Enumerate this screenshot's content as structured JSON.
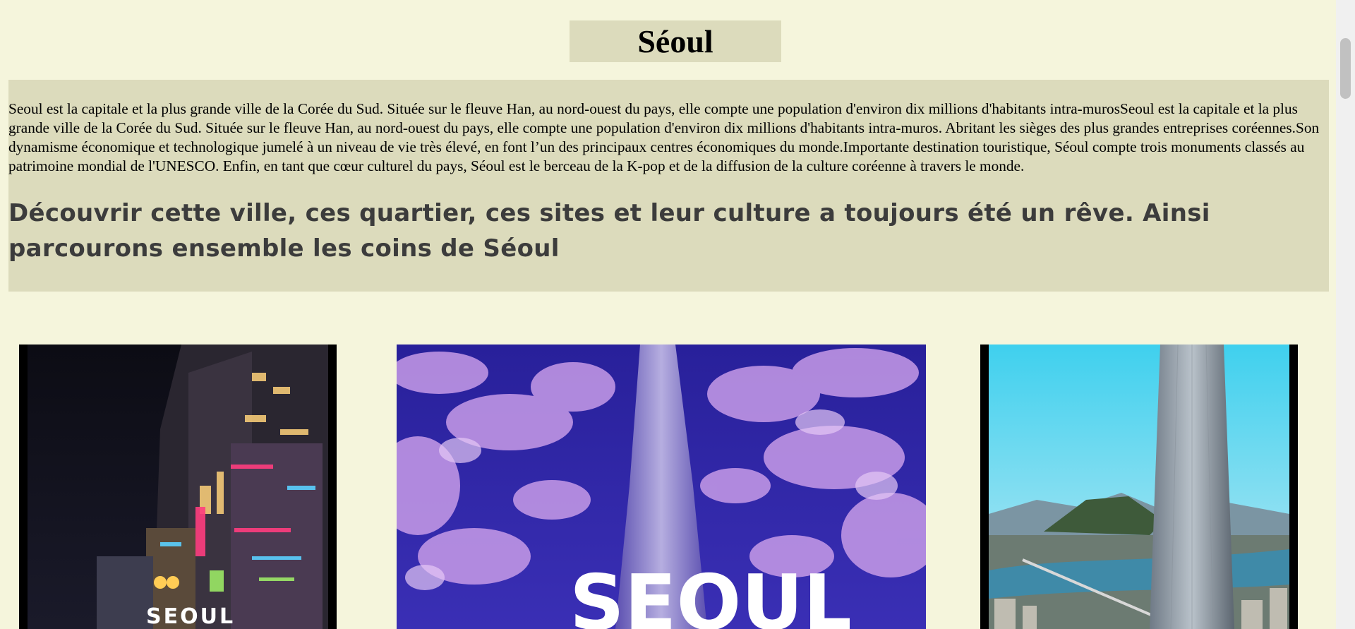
{
  "page": {
    "title": "Séoul",
    "intro_text": "Seoul est la capitale et la plus grande ville de la Corée du Sud. Située sur le fleuve Han, au nord-ouest du pays, elle compte une population d'environ dix millions d'habitants intra-murosSeoul est la capitale et la plus grande ville de la Corée du Sud. Située sur le fleuve Han, au nord-ouest du pays, elle compte une population d'environ dix millions d'habitants intra-muros. Abritant les sièges des plus grandes entreprises coréennes.Son dynamisme économique et technologique jumelé à un niveau de vie très élevé, en font l’un des principaux centres économiques du monde.Importante destination touristique, Séoul compte trois monuments classés au patrimoine mondial de l'UNESCO. Enfin, en tant que cœur culturel du pays, Séoul est le berceau de la K-pop et de la diffusion de la culture coréenne à travers le monde.",
    "tagline": "Découvrir cette ville, ces quartier, ces sites et leur culture a toujours été un rêve. Ainsi parcourons ensemble les coins de Séoul"
  },
  "photos": [
    {
      "overlay_text": "SEOUL"
    },
    {
      "overlay_text": "SEOUL"
    },
    {
      "overlay_text": ""
    }
  ],
  "colors": {
    "background": "#f5f5dc",
    "panel": "#dcdbbc",
    "tagline": "#3c3c3c"
  }
}
